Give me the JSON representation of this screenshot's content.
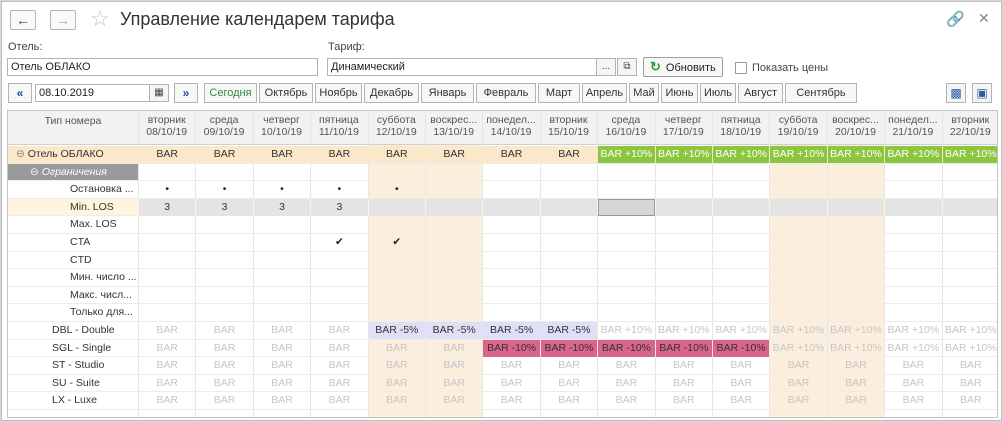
{
  "window": {
    "title": "Управление календарем тарифа"
  },
  "filters": {
    "hotel_label": "Отель:",
    "hotel_value": "Отель ОБЛАКО",
    "tariff_label": "Тариф:",
    "tariff_value": "Динамический",
    "refresh_label": "Обновить",
    "show_prices_label": "Показать цены",
    "picker_ellipsis": "...",
    "date_value": "08.10.2019"
  },
  "months": [
    "Сегодня",
    "Октябрь",
    "Ноябрь",
    "Декабрь",
    "Январь",
    "Февраль",
    "Март",
    "Апрель",
    "Май",
    "Июнь",
    "Июль",
    "Август",
    "Сентябрь"
  ],
  "table": {
    "type_header": "Тип номера",
    "days": [
      {
        "dow": "вторник",
        "date": "08/10/19",
        "weekend": false
      },
      {
        "dow": "среда",
        "date": "09/10/19",
        "weekend": false
      },
      {
        "dow": "четверг",
        "date": "10/10/19",
        "weekend": false
      },
      {
        "dow": "пятница",
        "date": "11/10/19",
        "weekend": false
      },
      {
        "dow": "суббота",
        "date": "12/10/19",
        "weekend": true
      },
      {
        "dow": "воскрес...",
        "date": "13/10/19",
        "weekend": true
      },
      {
        "dow": "понедел...",
        "date": "14/10/19",
        "weekend": false
      },
      {
        "dow": "вторник",
        "date": "15/10/19",
        "weekend": false
      },
      {
        "dow": "среда",
        "date": "16/10/19",
        "weekend": false
      },
      {
        "dow": "четверг",
        "date": "17/10/19",
        "weekend": false
      },
      {
        "dow": "пятница",
        "date": "18/10/19",
        "weekend": false
      },
      {
        "dow": "суббота",
        "date": "19/10/19",
        "weekend": true
      },
      {
        "dow": "воскрес...",
        "date": "20/10/19",
        "weekend": true
      },
      {
        "dow": "понедел...",
        "date": "21/10/19",
        "weekend": false
      },
      {
        "dow": "вторник",
        "date": "22/10/19",
        "weekend": false
      }
    ],
    "rows": [
      {
        "label": "Отель ОБЛАКО",
        "kind": "hotel",
        "cells": [
          "BAR",
          "BAR",
          "BAR",
          "BAR",
          "BAR",
          "BAR",
          "BAR",
          "BAR",
          "BAR +10%",
          "BAR +10%",
          "BAR +10%",
          "BAR +10%",
          "BAR +10%",
          "BAR +10%",
          "BAR +10%"
        ]
      },
      {
        "label": "Ограничения",
        "kind": "group",
        "cells": [
          "",
          "",
          "",
          "",
          "",
          "",
          "",
          "",
          "",
          "",
          "",
          "",
          "",
          "",
          ""
        ]
      },
      {
        "label": "Остановка ...",
        "kind": "restr",
        "cells": [
          "•",
          "•",
          "•",
          "•",
          "•",
          "",
          "",
          "",
          "",
          "",
          "",
          "",
          "",
          "",
          ""
        ]
      },
      {
        "label": "Min. LOS",
        "kind": "restr",
        "selected": true,
        "cells": [
          "3",
          "3",
          "3",
          "3",
          "",
          "",
          "",
          "",
          "",
          "",
          "",
          "",
          "",
          "",
          ""
        ]
      },
      {
        "label": "Max. LOS",
        "kind": "restr",
        "cells": [
          "",
          "",
          "",
          "",
          "",
          "",
          "",
          "",
          "",
          "",
          "",
          "",
          "",
          "",
          ""
        ]
      },
      {
        "label": "CTA",
        "kind": "restr",
        "cells": [
          "",
          "",
          "",
          "✔",
          "✔",
          "",
          "",
          "",
          "",
          "",
          "",
          "",
          "",
          "",
          ""
        ]
      },
      {
        "label": "CTD",
        "kind": "restr",
        "cells": [
          "",
          "",
          "",
          "",
          "",
          "",
          "",
          "",
          "",
          "",
          "",
          "",
          "",
          "",
          ""
        ]
      },
      {
        "label": "Мин. число ...",
        "kind": "restr",
        "cells": [
          "",
          "",
          "",
          "",
          "",
          "",
          "",
          "",
          "",
          "",
          "",
          "",
          "",
          "",
          ""
        ]
      },
      {
        "label": "Макс. числ...",
        "kind": "restr",
        "cells": [
          "",
          "",
          "",
          "",
          "",
          "",
          "",
          "",
          "",
          "",
          "",
          "",
          "",
          "",
          ""
        ]
      },
      {
        "label": "Только для...",
        "kind": "restr",
        "cells": [
          "",
          "",
          "",
          "",
          "",
          "",
          "",
          "",
          "",
          "",
          "",
          "",
          "",
          "",
          ""
        ]
      },
      {
        "label": "DBL - Double",
        "kind": "room",
        "cells": [
          "BAR",
          "BAR",
          "BAR",
          "BAR",
          "BAR -5%",
          "BAR -5%",
          "BAR -5%",
          "BAR -5%",
          "BAR +10%",
          "BAR +10%",
          "BAR +10%",
          "BAR +10%",
          "BAR +10%",
          "BAR +10%",
          "BAR +10%"
        ]
      },
      {
        "label": "SGL - Single",
        "kind": "room",
        "cells": [
          "BAR",
          "BAR",
          "BAR",
          "BAR",
          "BAR",
          "BAR",
          "BAR -10%",
          "BAR -10%",
          "BAR -10%",
          "BAR -10%",
          "BAR -10%",
          "BAR +10%",
          "BAR +10%",
          "BAR +10%",
          "BAR +10%"
        ]
      },
      {
        "label": "ST - Studio",
        "kind": "room",
        "cells": [
          "BAR",
          "BAR",
          "BAR",
          "BAR",
          "BAR",
          "BAR",
          "BAR",
          "BAR",
          "BAR",
          "BAR",
          "BAR",
          "BAR",
          "BAR",
          "BAR",
          "BAR"
        ]
      },
      {
        "label": "SU - Suite",
        "kind": "room",
        "cells": [
          "BAR",
          "BAR",
          "BAR",
          "BAR",
          "BAR",
          "BAR",
          "BAR",
          "BAR",
          "BAR",
          "BAR",
          "BAR",
          "BAR",
          "BAR",
          "BAR",
          "BAR"
        ]
      },
      {
        "label": "LX - Luxe",
        "kind": "room",
        "cells": [
          "BAR",
          "BAR",
          "BAR",
          "BAR",
          "BAR",
          "BAR",
          "BAR",
          "BAR",
          "BAR",
          "BAR",
          "BAR",
          "BAR",
          "BAR",
          "BAR",
          "BAR"
        ]
      }
    ]
  },
  "colors": {
    "green_rate": "#8cc63f",
    "pink_rate": "#d9668a",
    "lavender_rate": "#dfe0f7",
    "weekend": "#fbeedd",
    "hotel_row": "#fbe7c9",
    "group_row": "#9a9a9a",
    "selected_row": "#fff4dd"
  }
}
